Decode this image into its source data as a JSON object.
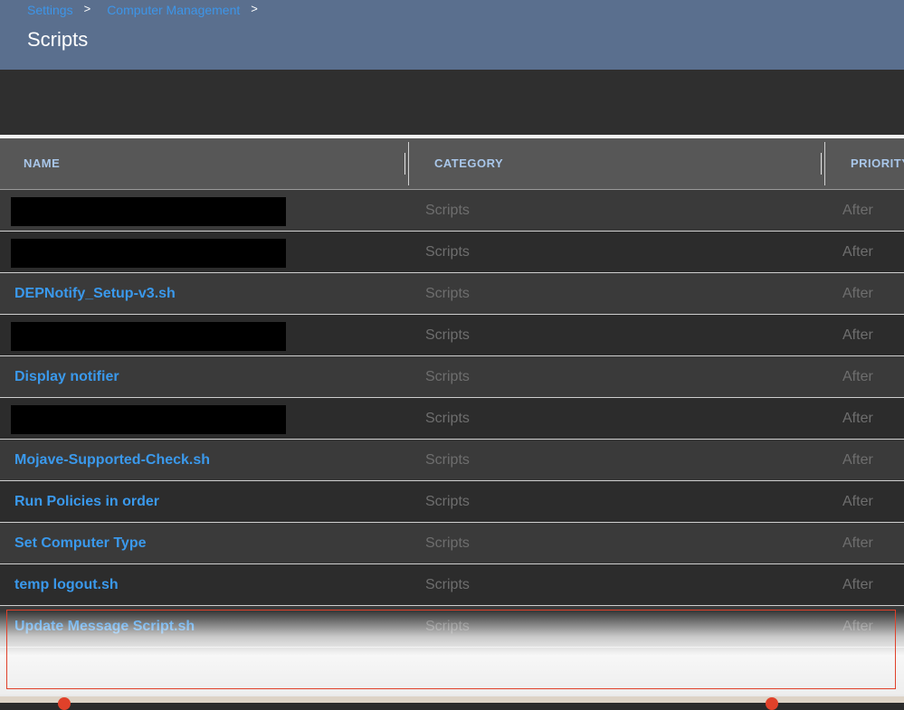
{
  "breadcrumb": {
    "items": [
      "Settings",
      "Computer Management"
    ],
    "separator": ">"
  },
  "page": {
    "title": "Scripts"
  },
  "table": {
    "columns": [
      "NAME",
      "CATEGORY",
      "PRIORITY"
    ],
    "rows": [
      {
        "name": "",
        "redacted": true,
        "category": "Scripts",
        "priority": "After"
      },
      {
        "name": "",
        "redacted": true,
        "category": "Scripts",
        "priority": "After"
      },
      {
        "name": "DEPNotify_Setup-v3.sh",
        "redacted": false,
        "category": "Scripts",
        "priority": "After"
      },
      {
        "name": "",
        "redacted": true,
        "category": "Scripts",
        "priority": "After"
      },
      {
        "name": "Display notifier",
        "redacted": false,
        "category": "Scripts",
        "priority": "After"
      },
      {
        "name": "",
        "redacted": true,
        "category": "Scripts",
        "priority": "After"
      },
      {
        "name": "Mojave-Supported-Check.sh",
        "redacted": false,
        "category": "Scripts",
        "priority": "After"
      },
      {
        "name": "Run Policies in order",
        "redacted": false,
        "category": "Scripts",
        "priority": "After"
      },
      {
        "name": "Set Computer Type",
        "redacted": false,
        "category": "Scripts",
        "priority": "After"
      },
      {
        "name": "temp logout.sh",
        "redacted": false,
        "category": "Scripts",
        "priority": "After"
      },
      {
        "name": "Update Message Script.sh",
        "redacted": false,
        "category": "Scripts",
        "priority": "After"
      }
    ]
  },
  "colors": {
    "header_bg": "#5a6f8e",
    "link": "#3a99ec",
    "column_header_text": "#a9c7ea",
    "highlight_border": "#e0412a"
  }
}
